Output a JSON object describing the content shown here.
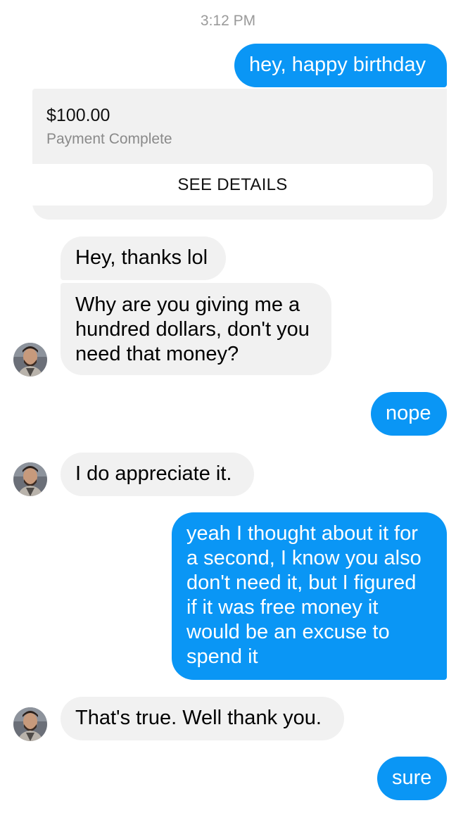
{
  "conversation": {
    "timestamp": "3:12 PM",
    "messages": [
      {
        "from": "me",
        "text": "hey, happy birthday"
      },
      {
        "from": "me",
        "type": "payment",
        "amount": "$100.00",
        "status": "Payment Complete",
        "action_label": "SEE DETAILS"
      },
      {
        "from": "them",
        "text": "Hey, thanks lol"
      },
      {
        "from": "them",
        "lines": [
          "Why are you giving me a",
          "hundred dollars, don't you",
          "need that money?"
        ]
      },
      {
        "from": "me",
        "text": "nope"
      },
      {
        "from": "them",
        "text": "I do appreciate it."
      },
      {
        "from": "me",
        "lines": [
          "yeah I thought about it for",
          "a second, I know you also",
          "don't need it, but I figured",
          "if it was free money it",
          "would be an excuse to",
          "spend it"
        ]
      },
      {
        "from": "them",
        "text": "That's true. Well thank you."
      },
      {
        "from": "me",
        "text": "sure"
      }
    ]
  },
  "colors": {
    "outgoing_bubble": "#0a96f5",
    "incoming_bubble": "#f1f1f1",
    "timestamp": "#9a9a9a"
  },
  "icons": {
    "contact_avatar": "contact-avatar-photo"
  }
}
